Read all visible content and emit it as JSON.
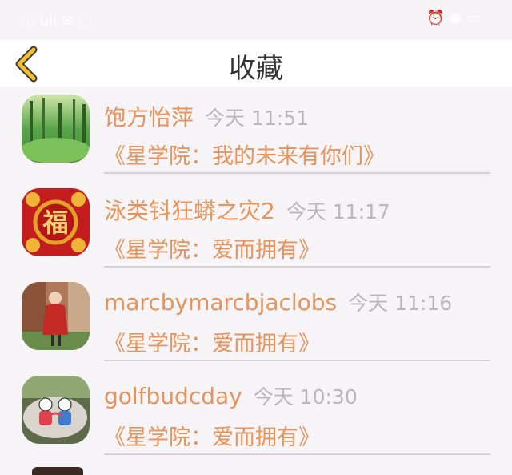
{
  "statusbar": {
    "left_text": "ⓘ ull ✉ ⬚",
    "right_text": "⏰ ◉ ▭"
  },
  "header": {
    "title": "收藏",
    "back_icon": "chevron-left-icon"
  },
  "items": [
    {
      "name": "饱方怡萍",
      "time": "今天 11:51",
      "subtitle": "《星学院：我的未来有你们》",
      "avatar": "forest-image"
    },
    {
      "name": "泳类钭狂蟒之灾2",
      "time": "今天 11:17",
      "subtitle": "《星学院：爱而拥有》",
      "avatar": "fu-character-image"
    },
    {
      "name": "marcbymarcbjaclobs",
      "time": "今天 11:16",
      "subtitle": "《星学院：爱而拥有》",
      "avatar": "woman-photo-image"
    },
    {
      "name": "golfbudcday",
      "time": "今天 10:30",
      "subtitle": "《星学院：爱而拥有》",
      "avatar": "painted-stone-image"
    }
  ],
  "colors": {
    "accent": "#e8935a",
    "time_gray": "#b8b8b8",
    "back_yellow": "#f2c12e"
  }
}
